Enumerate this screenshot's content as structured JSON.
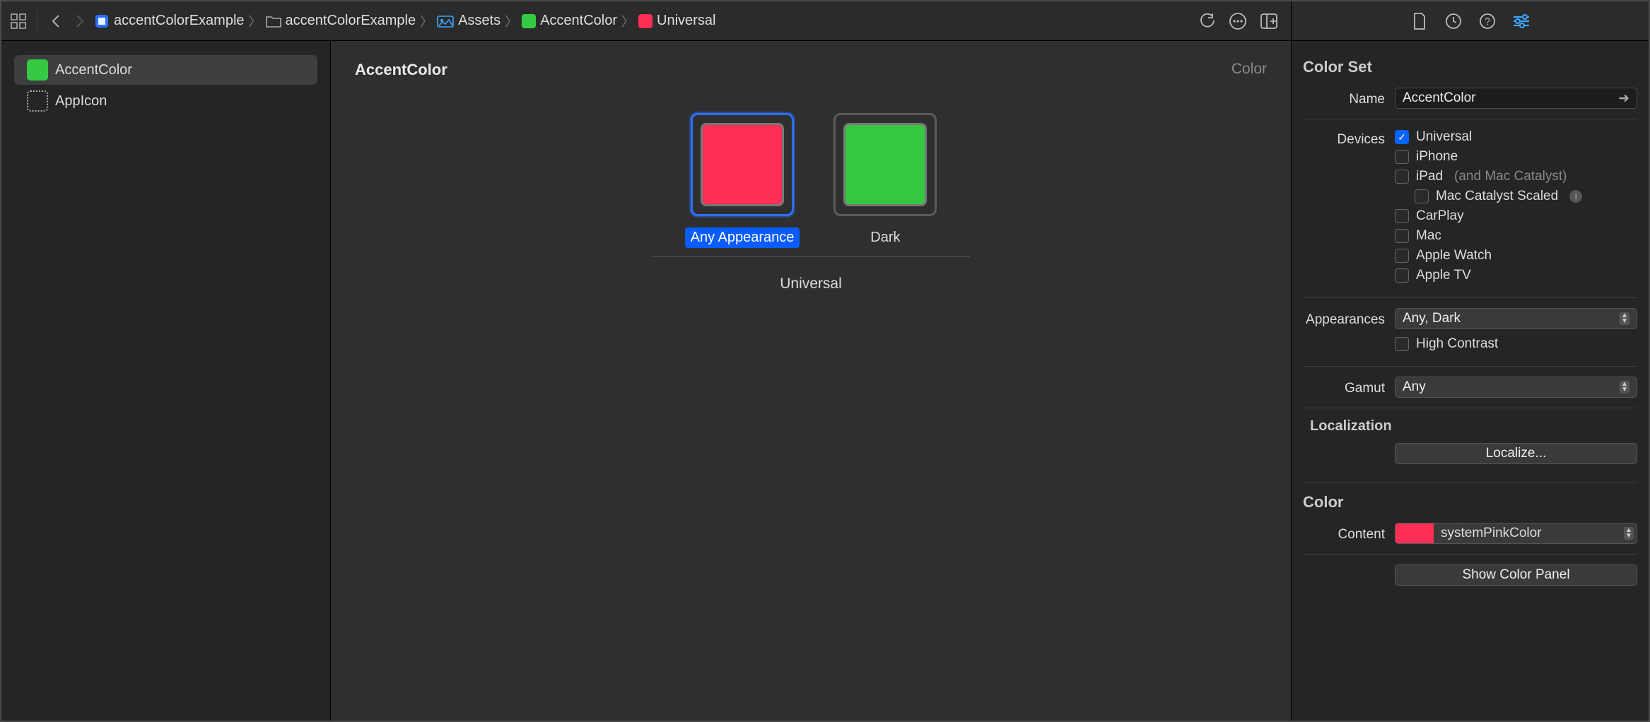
{
  "toolbar": {
    "breadcrumbs": {
      "project": "accentColorExample",
      "folder": "accentColorExample",
      "assets": "Assets",
      "color": "AccentColor",
      "variant": "Universal"
    },
    "colors": {
      "accent_swatch": "#35c943",
      "variant_swatch": "#ff2e55"
    }
  },
  "sidebar": {
    "items": [
      {
        "label": "AccentColor",
        "color": "#35c943",
        "selected": true,
        "type": "color"
      },
      {
        "label": "AppIcon",
        "type": "appicon",
        "selected": false
      }
    ]
  },
  "canvas": {
    "title": "AccentColor",
    "type_label": "Color",
    "swatches": [
      {
        "label": "Any Appearance",
        "color": "#ff2e55",
        "selected": true
      },
      {
        "label": "Dark",
        "color": "#35c943",
        "selected": false
      }
    ],
    "group_label": "Universal"
  },
  "inspector": {
    "section1": "Color Set",
    "name_label": "Name",
    "name_value": "AccentColor",
    "devices_label": "Devices",
    "devices": [
      {
        "label": "Universal",
        "checked": true
      },
      {
        "label": "iPhone",
        "checked": false
      },
      {
        "label": "iPad",
        "sub": "(and Mac Catalyst)",
        "checked": false
      },
      {
        "label": "Mac Catalyst Scaled",
        "checked": false,
        "indent": true,
        "info": true
      },
      {
        "label": "CarPlay",
        "checked": false
      },
      {
        "label": "Mac",
        "checked": false
      },
      {
        "label": "Apple Watch",
        "checked": false
      },
      {
        "label": "Apple TV",
        "checked": false
      }
    ],
    "appearances_label": "Appearances",
    "appearances_value": "Any, Dark",
    "high_contrast_label": "High Contrast",
    "gamut_label": "Gamut",
    "gamut_value": "Any",
    "localization_label": "Localization",
    "localize_btn": "Localize...",
    "section2": "Color",
    "content_label": "Content",
    "content_value": "systemPinkColor",
    "content_color": "#ff2e55",
    "show_panel_btn": "Show Color Panel"
  }
}
